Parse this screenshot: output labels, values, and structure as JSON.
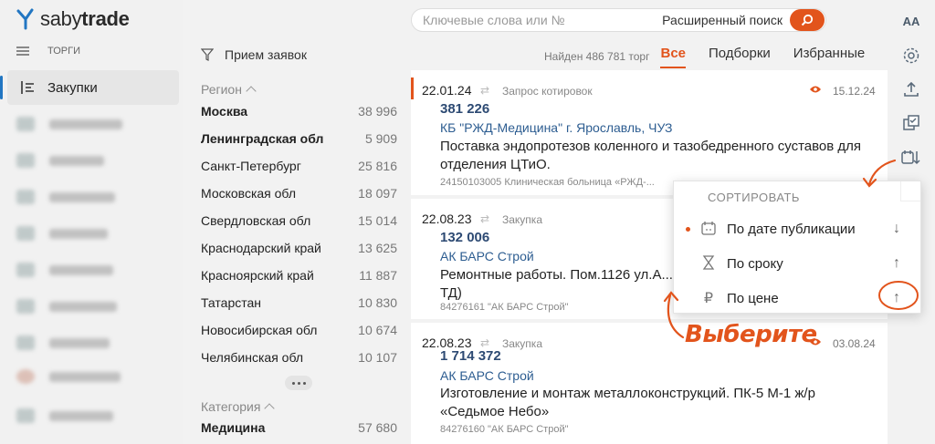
{
  "app": {
    "logo_light": "saby",
    "logo_bold": "trade"
  },
  "sidebar": {
    "section_label": "ТОРГИ",
    "active_item": "Закупки"
  },
  "filters": {
    "header": "Прием заявок",
    "region_title": "Регион",
    "regions": [
      {
        "name": "Москва",
        "count": "38 996",
        "bold": true
      },
      {
        "name": "Ленинградская обл",
        "count": "5 909",
        "bold": true
      },
      {
        "name": "Санкт-Петербург",
        "count": "25 816",
        "bold": false
      },
      {
        "name": "Московская обл",
        "count": "18 097",
        "bold": false
      },
      {
        "name": "Свердловская обл",
        "count": "15 014",
        "bold": false
      },
      {
        "name": "Краснодарский край",
        "count": "13 625",
        "bold": false
      },
      {
        "name": "Красноярский край",
        "count": "11 887",
        "bold": false
      },
      {
        "name": "Татарстан",
        "count": "10 830",
        "bold": false
      },
      {
        "name": "Новосибирская обл",
        "count": "10 674",
        "bold": false
      },
      {
        "name": "Челябинская обл",
        "count": "10 107",
        "bold": false
      }
    ],
    "category_title": "Категория",
    "categories": [
      {
        "name": "Медицина",
        "count": "57 680"
      }
    ]
  },
  "search": {
    "placeholder": "Ключевые слова или №",
    "advanced": "Расширенный поиск"
  },
  "tabs": {
    "found": "Найден 486 781 торг",
    "items": [
      "Все",
      "Подборки",
      "Избранные"
    ]
  },
  "rail": {
    "font_toggle": "AA"
  },
  "cards": [
    {
      "date": "22.01.24",
      "type": "Запрос котировок",
      "price": "381 226",
      "org": "КБ \"РЖД-Медицина\" г. Ярославль, ЧУЗ",
      "desc": "Поставка эндопротезов коленного и тазобедренного суставов для отделения ЦТиО.",
      "meta": "24150103005  Клиническая больница «РЖД-...",
      "date2": "15.12.24",
      "marked": true
    },
    {
      "date": "22.08.23",
      "type": "Закупка",
      "price": "132 006",
      "org": "АК БАРС Строй",
      "desc": "Ремонтные работы. Пом.1126 ул.А... ТД)",
      "meta": "84276161  \"АК БАРС Строй\"",
      "date2": "",
      "marked": false
    },
    {
      "date": "22.08.23",
      "type": "Закупка",
      "price": "1 714 372",
      "org": "АК БАРС Строй",
      "desc": "Изготовление и монтаж металлоконструкций. ПК-5 М-1 ж/р «Седьмое Небо»",
      "meta": "84276160  \"АК БАРС Строй\"",
      "date2": "03.08.24",
      "marked": false
    }
  ],
  "sort_popup": {
    "title": "СОРТИРОВАТЬ",
    "options": [
      {
        "label": "По дате публикации",
        "icon": "calendar-icon",
        "arrow": "↓",
        "selected": true
      },
      {
        "label": "По сроку",
        "icon": "hourglass-icon",
        "arrow": "↑",
        "selected": false
      },
      {
        "label": "По цене",
        "icon": "ruble-icon",
        "arrow": "↑",
        "selected": false
      }
    ]
  },
  "annotation": "Выберите",
  "colors": {
    "accent": "#e2541c",
    "link": "#2d5d91",
    "sidebar_active_bar": "#2276c2"
  }
}
